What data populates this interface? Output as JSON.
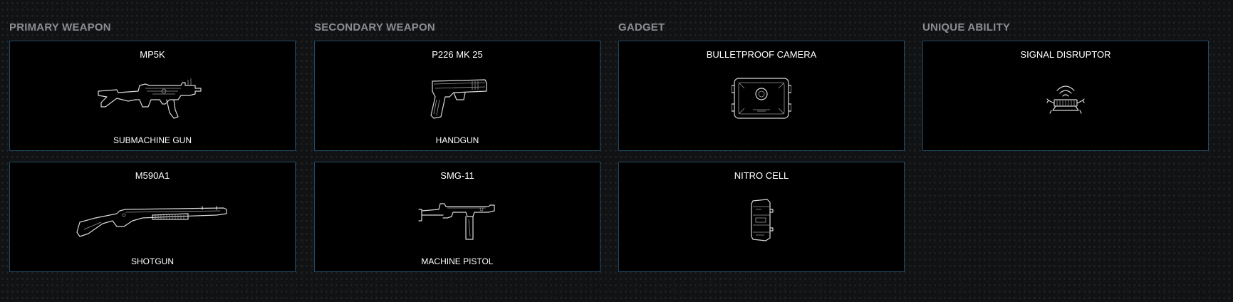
{
  "columns": [
    {
      "title": "PRIMARY WEAPON",
      "cards": [
        {
          "name": "MP5K",
          "type": "SUBMACHINE GUN",
          "icon": "mp5k-icon"
        },
        {
          "name": "M590A1",
          "type": "SHOTGUN",
          "icon": "shotgun-icon"
        }
      ]
    },
    {
      "title": "SECONDARY WEAPON",
      "cards": [
        {
          "name": "P226 MK 25",
          "type": "HANDGUN",
          "icon": "handgun-icon"
        },
        {
          "name": "SMG-11",
          "type": "MACHINE PISTOL",
          "icon": "machine-pistol-icon"
        }
      ]
    },
    {
      "title": "GADGET",
      "cards": [
        {
          "name": "BULLETPROOF CAMERA",
          "type": "",
          "icon": "bulletproof-camera-icon"
        },
        {
          "name": "NITRO CELL",
          "type": "",
          "icon": "nitro-cell-icon"
        }
      ]
    },
    {
      "title": "UNIQUE ABILITY",
      "cards": [
        {
          "name": "SIGNAL DISRUPTOR",
          "type": "",
          "icon": "signal-disruptor-icon"
        }
      ]
    }
  ],
  "colors": {
    "background": "#111213",
    "card_background": "#000000",
    "card_border": "#224a66",
    "section_title": "#8a8d92",
    "card_text": "#ffffff"
  }
}
